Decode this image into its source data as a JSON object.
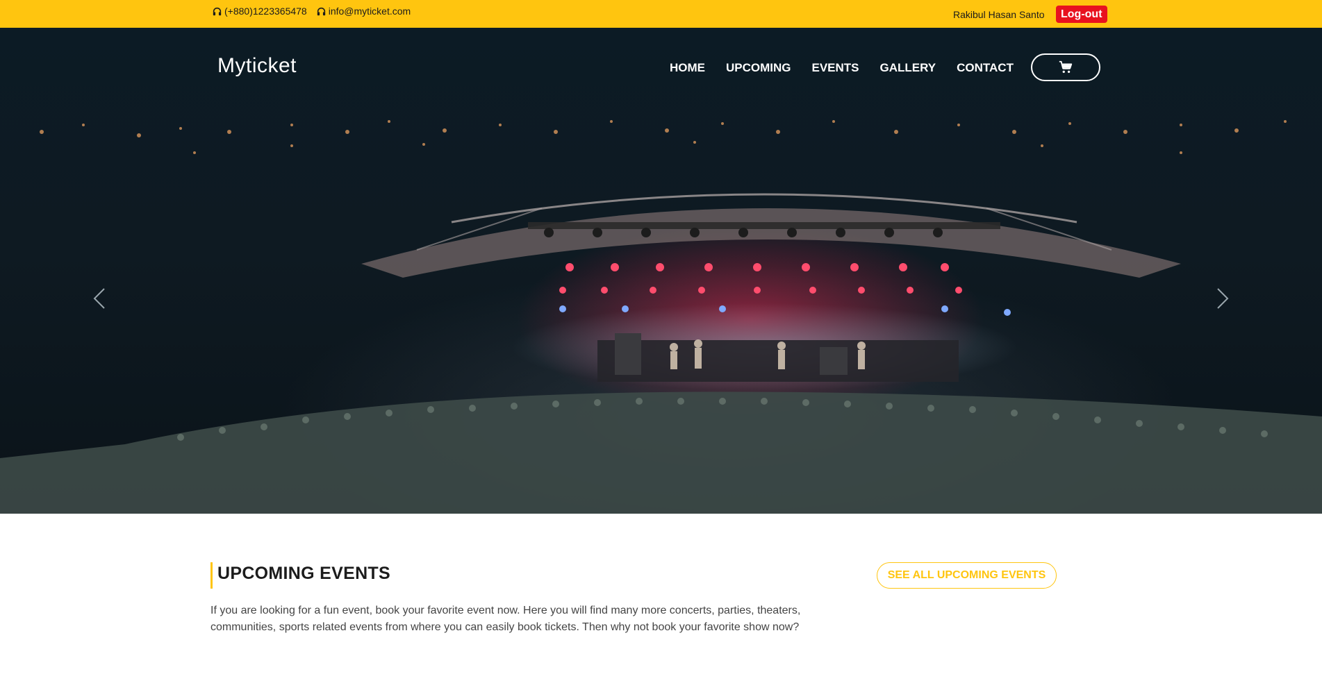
{
  "topbar": {
    "phone": "(+880)1223365478",
    "email": "info@myticket.com",
    "username": "Rakibul Hasan Santo",
    "logout_label": "Log-out",
    "background": "#ffc50f",
    "logout_color": "#e8121f"
  },
  "nav": {
    "brand": "Myticket",
    "items": [
      {
        "label": "HOME"
      },
      {
        "label": "UPCOMING"
      },
      {
        "label": "EVENTS"
      },
      {
        "label": "GALLERY"
      },
      {
        "label": "CONTACT"
      }
    ],
    "cart_icon": "cart-icon"
  },
  "hero": {
    "image": "concert-stage-crowd-at-night",
    "prev_icon": "chevron-left-icon",
    "next_icon": "chevron-right-icon"
  },
  "upcoming": {
    "title": "UPCOMING EVENTS",
    "see_all_label": "SEE ALL UPCOMING EVENTS",
    "description": "If you are looking for a fun event, book your favorite event now. Here you will find many more concerts, parties, theaters, communities, sports related events from where you can easily book tickets. Then why not book your favorite show now?",
    "accent": "#ffc50f"
  }
}
